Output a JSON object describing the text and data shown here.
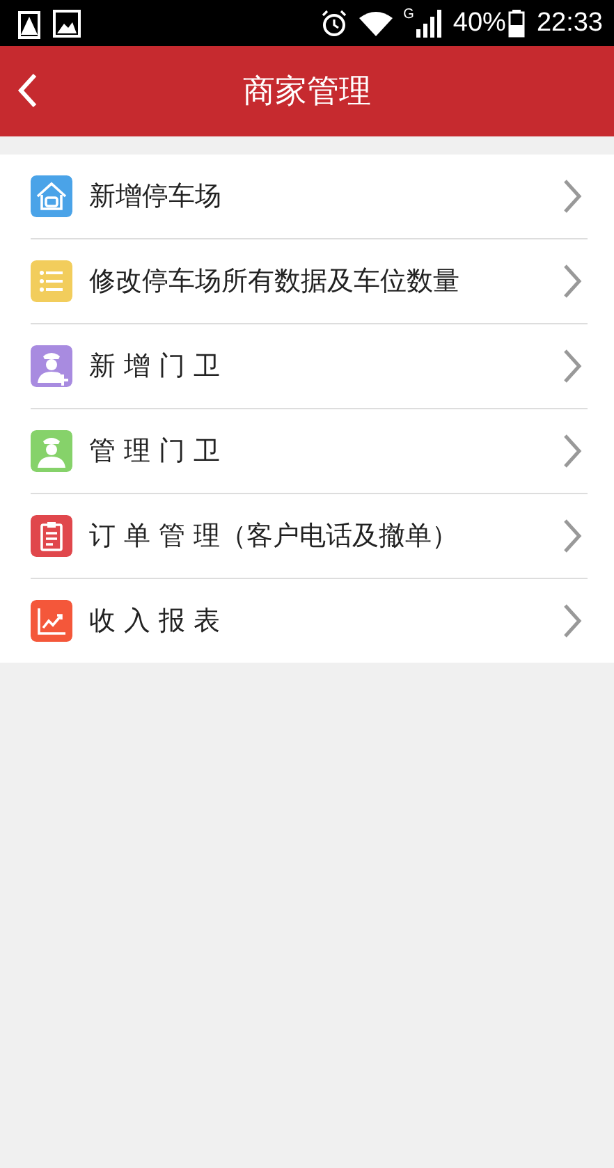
{
  "status_bar": {
    "network": "G",
    "battery": "40%",
    "time": "22:33"
  },
  "header": {
    "title": "商家管理"
  },
  "menu": [
    {
      "label": "新增停车场",
      "kind": "house",
      "color": "#4aa3e8"
    },
    {
      "label": "修改停车场所有数据及车位数量",
      "kind": "list",
      "color": "#f2cd5c"
    },
    {
      "label": "新 增 门 卫",
      "kind": "guard-add",
      "color": "#a88be0"
    },
    {
      "label": "管 理 门 卫",
      "kind": "guard",
      "color": "#86d26a"
    },
    {
      "label": "订 单 管 理（客户电话及撤单）",
      "kind": "clipboard",
      "color": "#e0474c"
    },
    {
      "label": "收 入 报 表",
      "kind": "chart",
      "color": "#f4573a"
    }
  ]
}
